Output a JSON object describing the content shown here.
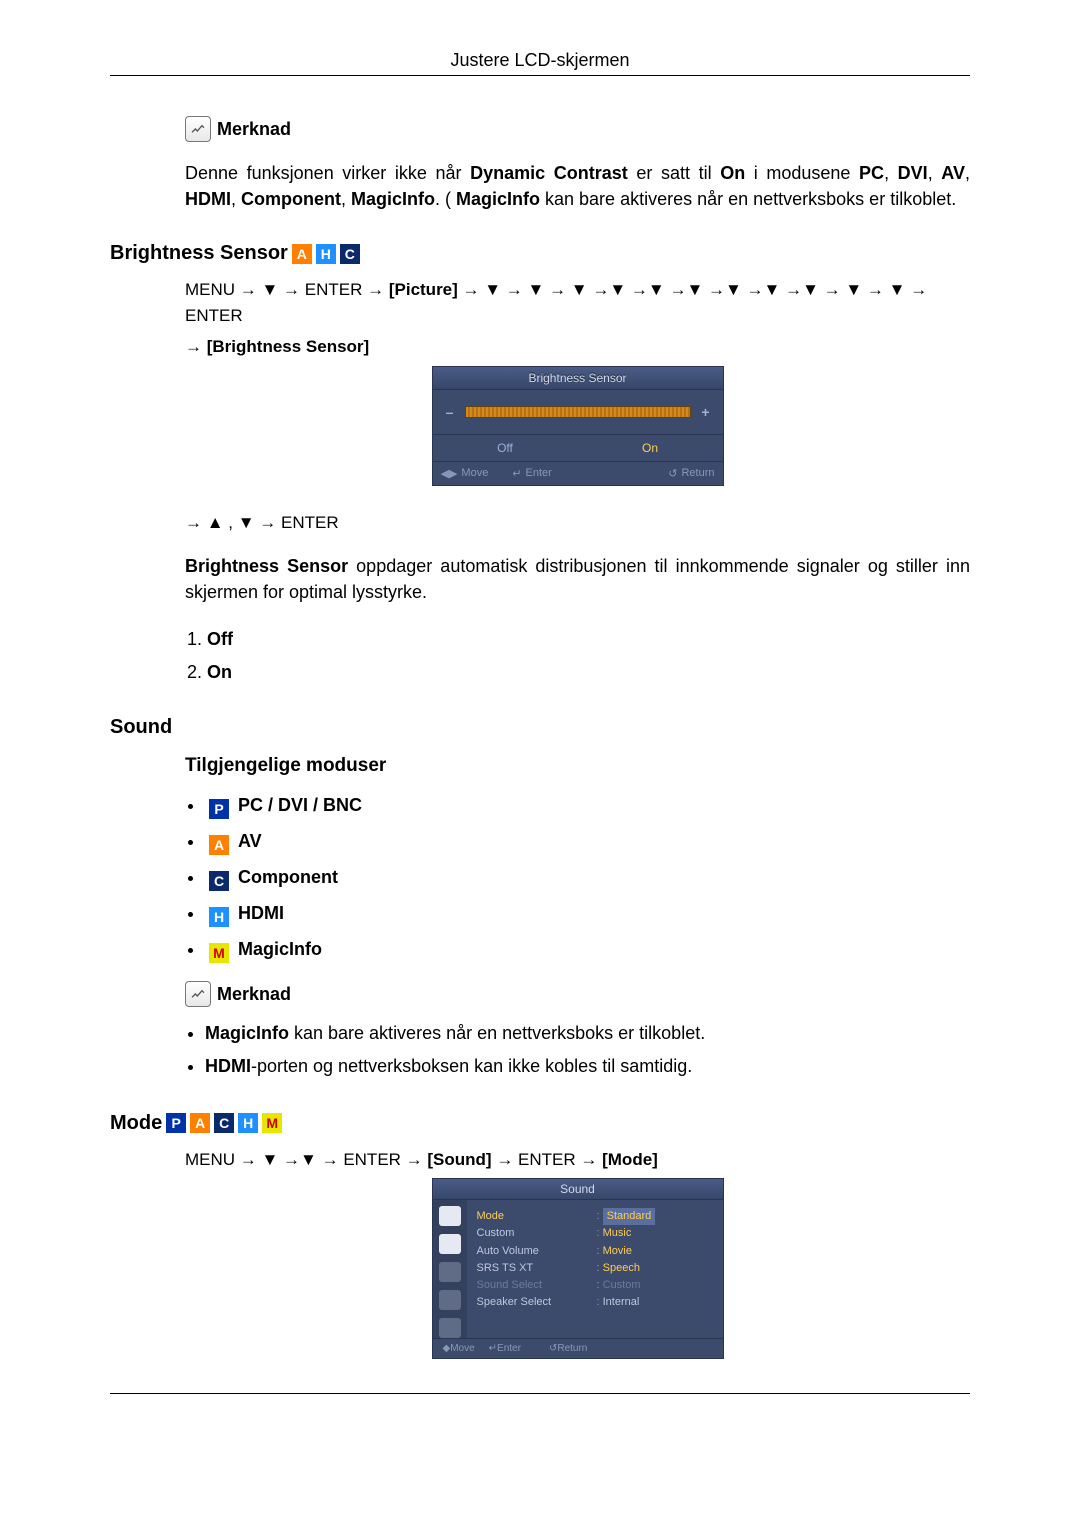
{
  "header": {
    "title": "Justere LCD-skjermen"
  },
  "note_label": "Merknad",
  "note_paragraph_parts": {
    "a": "Denne funksjonen virker ikke når ",
    "dc": "Dynamic Contrast",
    "b": " er satt til ",
    "on": "On",
    "c": " i modusene ",
    "pc": "PC",
    "sep": ", ",
    "dvi": "DVI",
    "av": "AV",
    "hdmi": "HDMI",
    "comp": "Component",
    "mi": "MagicInfo",
    "d": ". ( ",
    "mi2": "MagicInfo",
    "e": " kan bare aktiveres når en nettverksboks er tilkoblet."
  },
  "brightness": {
    "heading": "Brightness Sensor",
    "nav_parts": {
      "a": "MENU → ▼ → ENTER → ",
      "pic": "[Picture]",
      "b": " → ▼ → ▼ → ▼ →▼ →▼ →▼ →▼ →▼ →▼ → ▼ → ▼ → ENTER",
      "c": "→ ",
      "bs": "[Brightness Sensor]"
    },
    "osd": {
      "title": "Brightness Sensor",
      "minus": "–",
      "plus": "+",
      "off": "Off",
      "on": "On",
      "move": "Move",
      "enter": "Enter",
      "return": "Return"
    },
    "nav2": "→ ▲ , ▼ → ENTER",
    "desc_parts": {
      "bs": "Brightness Sensor",
      "rest": " oppdager automatisk distribusjonen til innkommende signaler og stiller inn skjermen for optimal lysstyrke."
    },
    "list": {
      "off": "Off",
      "on": "On"
    }
  },
  "sound": {
    "heading": "Sound",
    "sub": "Tilgjengelige moduser",
    "modes": {
      "p_label": "PC / DVI / BNC",
      "a_label": "AV",
      "c_label": "Component",
      "h_label": "HDMI",
      "m_label": "MagicInfo"
    },
    "note_label": "Merknad",
    "note_items": {
      "i1": {
        "b": "MagicInfo",
        "rest": " kan bare aktiveres når en nettverksboks er tilkoblet."
      },
      "i2": {
        "b": "HDMI",
        "rest": "-porten og nettverksboksen kan ikke kobles til samtidig."
      }
    }
  },
  "mode": {
    "heading": "Mode",
    "nav_parts": {
      "a": "MENU → ▼ →▼ → ENTER → ",
      "sound": "[Sound]",
      "b": " → ENTER → ",
      "mode": "[Mode]"
    },
    "osd": {
      "title": "Sound",
      "left": {
        "mode": "Mode",
        "custom": "Custom",
        "auto_volume": "Auto Volume",
        "srs": "SRS TS XT",
        "sound_select": "Sound Select",
        "speaker_select": "Speaker Select"
      },
      "right": {
        "standard": "Standard",
        "music": "Music",
        "movie": "Movie",
        "speech": "Speech",
        "custom": "Custom",
        "internal": "Internal"
      },
      "move": "Move",
      "enter": "Enter",
      "return": "Return"
    }
  },
  "tags": {
    "A": "A",
    "H": "H",
    "C": "C",
    "P": "P",
    "M": "M"
  }
}
